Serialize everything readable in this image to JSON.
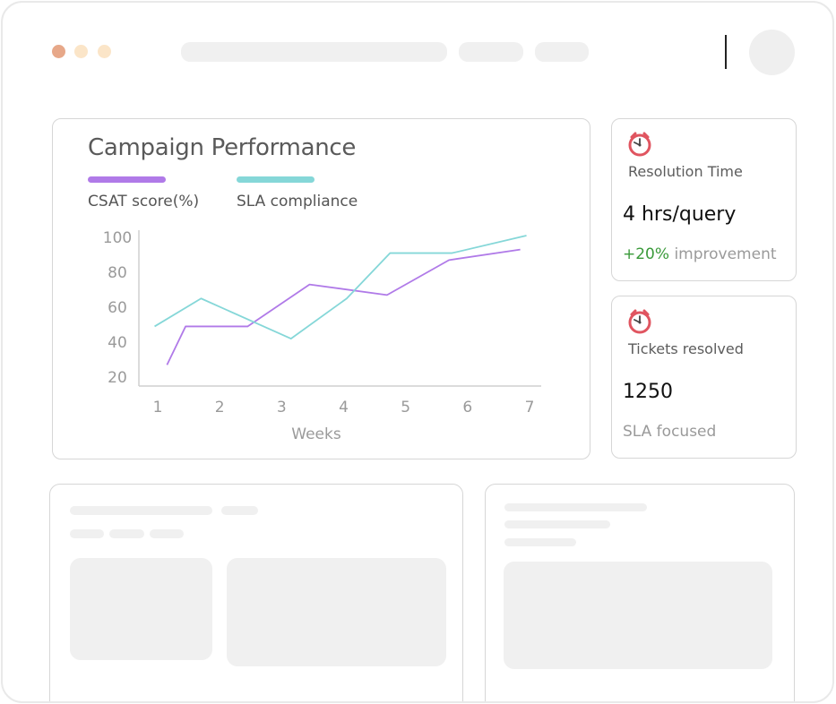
{
  "window": {
    "dots": [
      "#e7a889",
      "#fbe5c8",
      "#fbe5c8"
    ]
  },
  "chart_card": {
    "title": "Campaign Performance",
    "chart_data": {
      "type": "line",
      "x": [
        1,
        2,
        3,
        4,
        5,
        6,
        7
      ],
      "xlabel": "Weeks",
      "ylabel": "",
      "yticks": [
        20,
        40,
        60,
        80,
        100
      ],
      "xlim": [
        1,
        7
      ],
      "ylim": [
        20,
        100
      ],
      "legend_placement": "top-left",
      "series": [
        {
          "name": "CSAT score(%)",
          "color": "#b07ae8",
          "x": [
            1.15,
            1.45,
            2.45,
            3.45,
            4.7,
            5.7,
            6.85
          ],
          "values": [
            27,
            49,
            49,
            73,
            67,
            87,
            93
          ]
        },
        {
          "name": "SLA compliance",
          "color": "#85d7d8",
          "x": [
            0.95,
            1.7,
            3.15,
            4.05,
            4.75,
            5.75,
            6.95
          ],
          "values": [
            49,
            65,
            42,
            65,
            91,
            91,
            101
          ]
        }
      ]
    }
  },
  "stats": [
    {
      "icon": "alarm-clock-icon",
      "title": "Resolution Time",
      "value": "4 hrs/query",
      "foot_highlight": "+20%",
      "foot_text": "improvement"
    },
    {
      "icon": "alarm-clock-icon",
      "title": "Tickets resolved",
      "value": "1250",
      "foot_highlight": "",
      "foot_text": "SLA focused"
    }
  ]
}
